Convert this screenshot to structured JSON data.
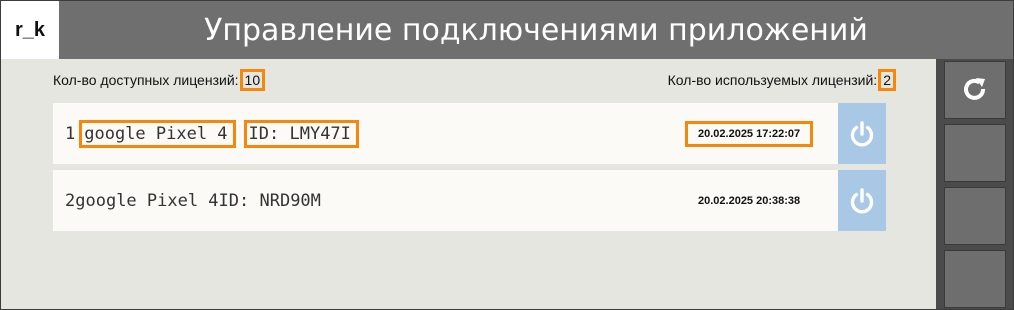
{
  "logo": {
    "text": "r_k"
  },
  "header": {
    "title": "Управление подключениями приложений"
  },
  "licenses": {
    "available_label": "Кол-во доступных лицензий:",
    "available_value": "10",
    "used_label": "Кол-во используемых лицензий:",
    "used_value": "2"
  },
  "connections": [
    {
      "index": "1",
      "device": "google Pixel 4",
      "id": "ID: LMY47I",
      "datetime": "20.02.2025 17:22:07",
      "icon": "power-icon"
    },
    {
      "index": "2",
      "device": "google Pixel 4",
      "id": "ID: NRD90M",
      "datetime": "20.02.2025 20:38:38",
      "icon": "power-icon"
    }
  ],
  "sidebar": {
    "refresh_icon": "refresh-icon"
  },
  "colors": {
    "header_bg": "#6f6f6f",
    "highlight": "#f7870a",
    "power_button": "#a8c8e6",
    "sidebar_bg": "#4b4b4b"
  }
}
